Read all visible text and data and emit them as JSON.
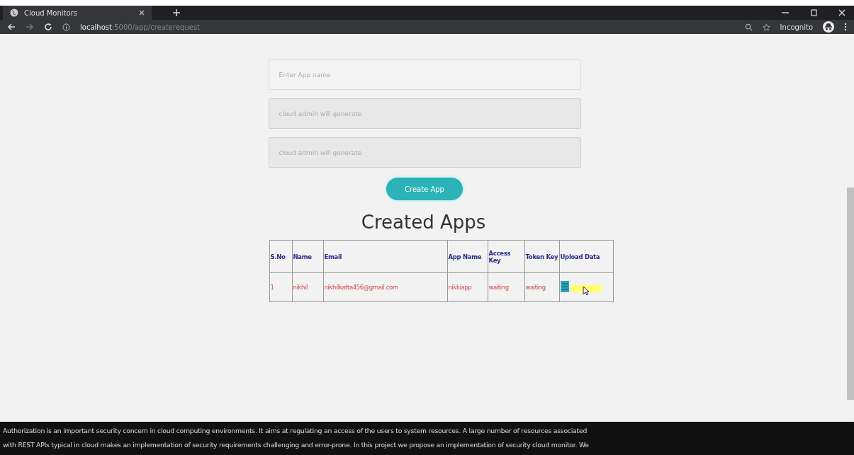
{
  "browser": {
    "tab_title": "Cloud Monitors",
    "url_host": "localhost",
    "url_path": ":5000/app/createrequest",
    "profile_label": "Incognito"
  },
  "form": {
    "fields": [
      {
        "placeholder": "Enter App name",
        "disabled": false
      },
      {
        "placeholder": "cloud admin will generate",
        "disabled": true
      },
      {
        "placeholder": "cloud admin will generate",
        "disabled": true
      }
    ],
    "button": "Create App"
  },
  "table": {
    "title": "Created Apps",
    "columns": [
      "S.No",
      "Name",
      "Email",
      "App Name",
      "Access Key",
      "Token Key",
      "Upload Data"
    ],
    "rows": [
      {
        "cells": [
          "1",
          "nikhil",
          "nikhilkatta456@gmail.com",
          "nikkiapp",
          "waiting",
          "waiting"
        ]
      }
    ]
  },
  "footer": {
    "lines": [
      "Authorization is an important security concern in cloud computing environments. It aims at regulating an access of the users to system resources. A large number of resources associated",
      "with REST APIs typical in cloud makes an implementation of security requirements challenging and error-prone. In this project we propose an implementation of security cloud monitor. We"
    ]
  }
}
